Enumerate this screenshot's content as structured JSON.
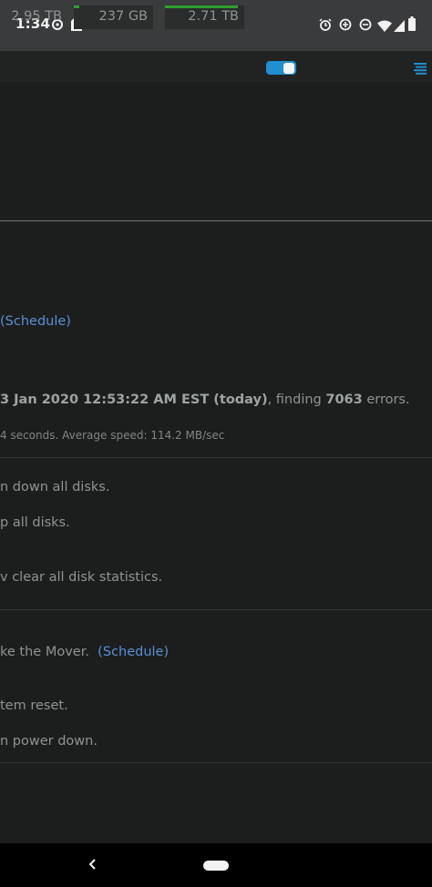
{
  "status_bar": {
    "time": "1:34",
    "left_icons": [
      "sync-icon",
      "sim-card-icon"
    ],
    "right_icons": [
      "alarm-icon",
      "data-saver-icon",
      "do-not-disturb-icon",
      "wifi-icon",
      "signal-icon",
      "battery-icon"
    ]
  },
  "top_bar": {
    "stats": [
      {
        "label": "2.95 TB",
        "has_bar": false,
        "fill_fraction": 0
      },
      {
        "label": "237 GB",
        "has_bar": true,
        "fill_fraction": 0.07
      },
      {
        "label": "2.71 TB",
        "has_bar": true,
        "fill_fraction": 0.92
      }
    ],
    "toggle_on": true,
    "menu_icon": "menu-lines-icon"
  },
  "content": {
    "schedule_link_1": "(Schedule)",
    "parity_line": {
      "prefix": "3 Jan 2020 12:53:22 AM EST (today)",
      "mid": ", finding ",
      "errors": "7063",
      "suffix": " errors."
    },
    "speed_line": "4 seconds. Average speed: 114.2 MB/sec",
    "spin_down": "n down all disks.",
    "spin_up": "p all disks.",
    "clear_stats": "v clear all disk statistics.",
    "mover_text": "ke the Mover.",
    "schedule_link_2": "(Schedule)",
    "reset_text": "tem reset.",
    "power_down": "n power down."
  },
  "nav_bar": {
    "back_icon": "back-chevron-icon",
    "home_icon": "home-pill-icon"
  },
  "colors": {
    "background": "#1c1e1d",
    "status_bar": "#3a3b3c",
    "accent_blue": "#1f8fd1",
    "link": "#5a8fd6",
    "bar_green": "#2fa12f"
  }
}
